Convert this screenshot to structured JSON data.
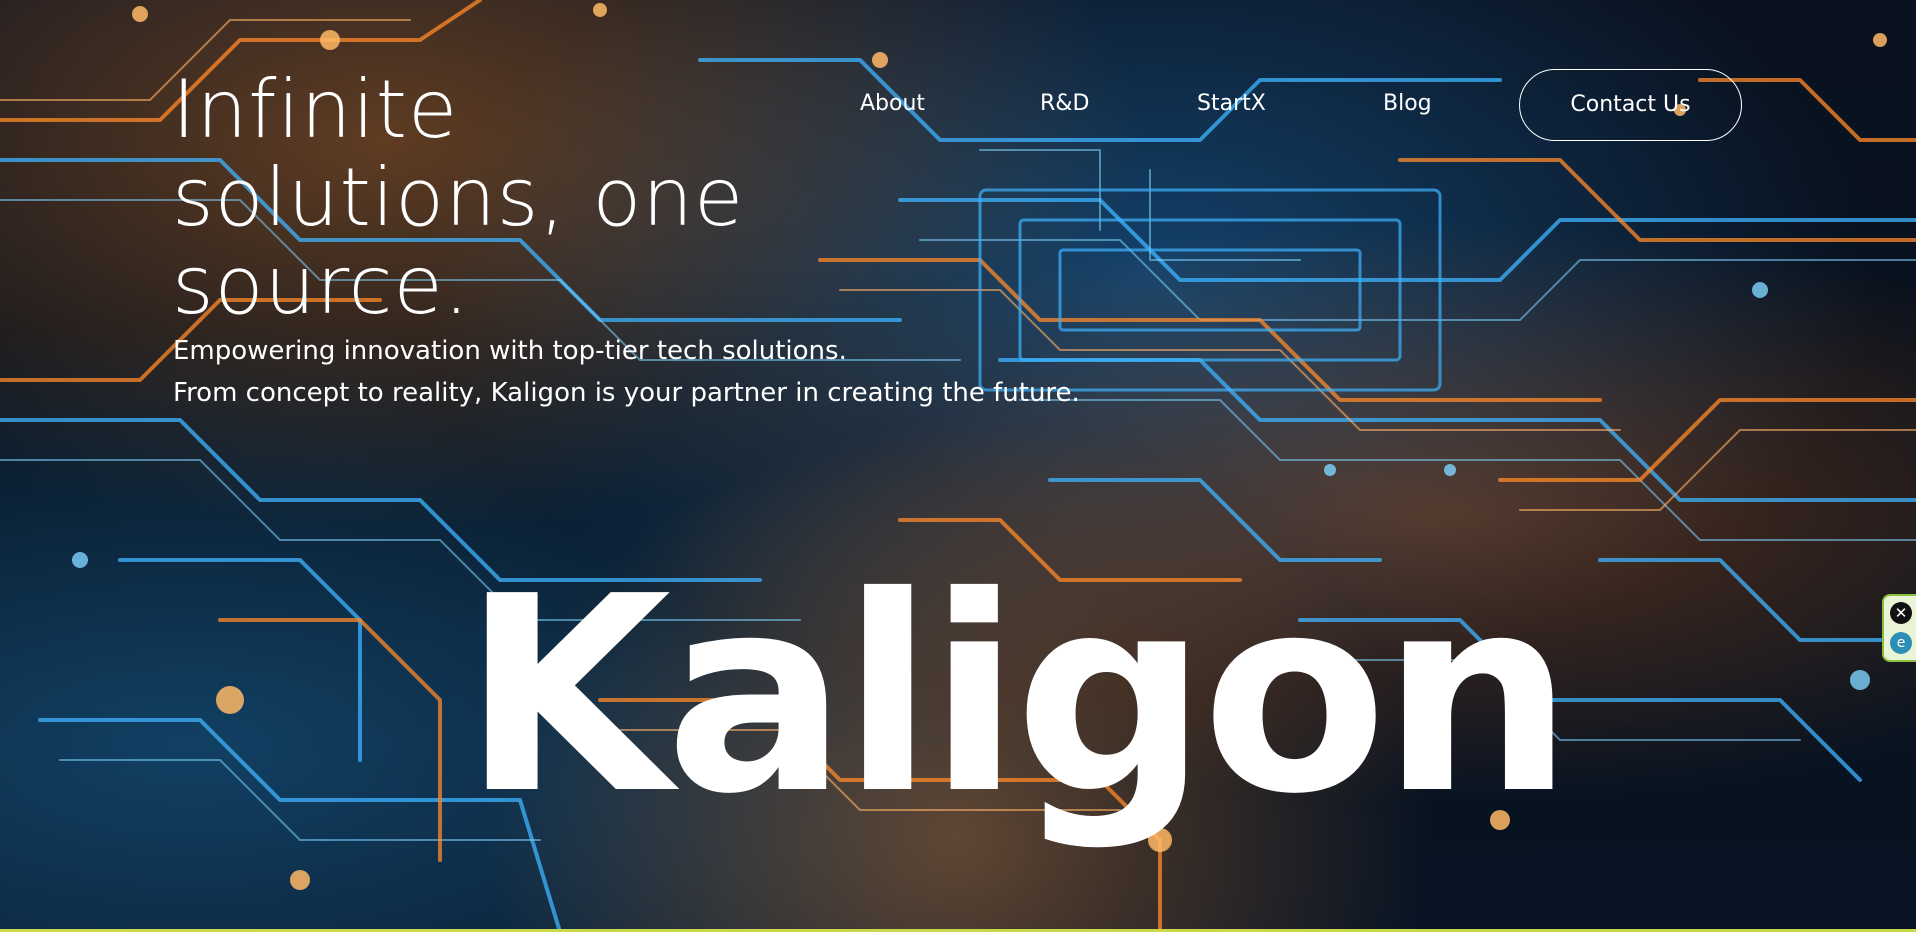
{
  "hero": {
    "headline_lines": [
      "Infinite",
      "solutions, one",
      "source."
    ],
    "tagline_lines": [
      "Empowering innovation with top-tier tech solutions.",
      "From concept to reality, Kaligon is your partner in creating the future."
    ],
    "brand": "Kaligon",
    "background_image": "circuit-board-background"
  },
  "nav": {
    "items": [
      {
        "label": "About"
      },
      {
        "label": "R&D"
      },
      {
        "label": "StartX"
      },
      {
        "label": "Blog"
      }
    ],
    "contact_label": "Contact Us"
  },
  "browser_extension": {
    "close_icon": "close-icon",
    "close_glyph": "✕",
    "logo_icon": "extension-logo-icon",
    "logo_glyph": "e"
  },
  "colors": {
    "text": "#ffffff",
    "circuit_blue": "#3fb4ff",
    "circuit_orange": "#ff8a2a",
    "background_dark": "#07101c",
    "extension_accent": "#8cbf3f"
  }
}
